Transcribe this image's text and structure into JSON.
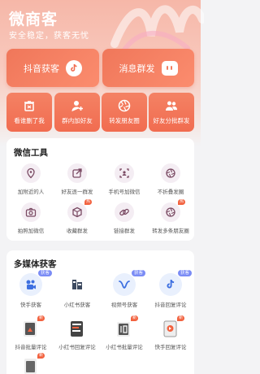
{
  "header": {
    "title": "微商客",
    "subtitle": "安全稳定，获客无忧"
  },
  "primary_actions": [
    {
      "label": "抖音获客",
      "icon": "tiktok-icon"
    },
    {
      "label": "消息群发",
      "icon": "message-icon"
    }
  ],
  "quick_actions": [
    {
      "label": "看谁删了我",
      "icon": "trash-icon"
    },
    {
      "label": "群内加好友",
      "icon": "add-user-icon"
    },
    {
      "label": "转发朋友圈",
      "icon": "aperture-icon"
    },
    {
      "label": "好友分批群发",
      "icon": "group-icon"
    }
  ],
  "wechat_tools": {
    "title": "微信工具",
    "items": [
      {
        "label": "加附近的人",
        "icon": "location-icon"
      },
      {
        "label": "好友逐一群发",
        "icon": "forward-icon"
      },
      {
        "label": "手机号加微信",
        "icon": "phone-id-icon"
      },
      {
        "label": "不折叠发圈",
        "icon": "no-fold-icon"
      },
      {
        "label": "拍照加微信",
        "icon": "camera-icon"
      },
      {
        "label": "收藏群发",
        "icon": "box-icon",
        "badge": "热"
      },
      {
        "label": "链接群发",
        "icon": "link-icon"
      },
      {
        "label": "转发多条朋友圈",
        "icon": "aperture-icon",
        "badge": "热"
      }
    ]
  },
  "media_tools": {
    "title": "多媒体获客",
    "items": [
      {
        "label": "快手获客",
        "icon": "kuaishou-icon",
        "badge": "获客"
      },
      {
        "label": "小红书获客",
        "icon": "xiaohongshu-icon"
      },
      {
        "label": "视频号获客",
        "icon": "channels-icon",
        "badge": "获客"
      },
      {
        "label": "抖音回复评论",
        "icon": "tiktok-icon",
        "badge": "获客"
      },
      {
        "label": "抖音批量评论",
        "icon": "douyin-doc-icon",
        "badge": "新"
      },
      {
        "label": "小红书回复评论",
        "icon": "xhs-doc-icon"
      },
      {
        "label": "小红书批量评论",
        "icon": "xhs-batch-icon",
        "badge": "新"
      },
      {
        "label": "快手回复评论",
        "icon": "ks-doc-icon",
        "badge": "新"
      }
    ]
  },
  "colors": {
    "accent": "#f16c50",
    "tool_icon": "#7a4a63",
    "media_icon": "#3d6fe0"
  }
}
